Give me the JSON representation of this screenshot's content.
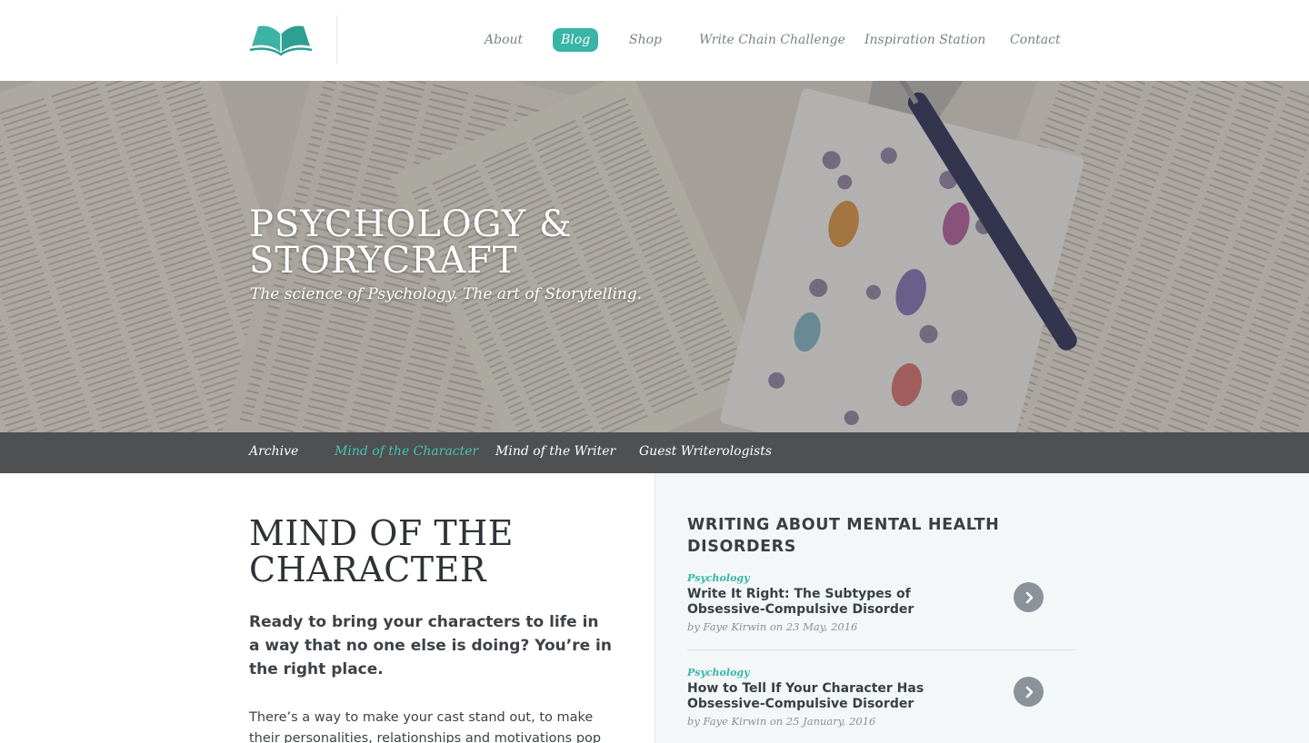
{
  "header": {
    "logo_icon": "open-book-icon",
    "nav": [
      {
        "label": "About",
        "active": false
      },
      {
        "label": "Blog",
        "active": true
      },
      {
        "label": "Shop",
        "active": false
      },
      {
        "label": "Write Chain Challenge",
        "active": false
      },
      {
        "label": "Inspiration Station",
        "active": false
      },
      {
        "label": "Contact",
        "active": false
      }
    ]
  },
  "hero": {
    "title_line1": "PSYCHOLOGY &",
    "title_line2": "STORYCRAFT",
    "subtitle": "The science of Psychology. The art of Storytelling."
  },
  "subnav": {
    "items": [
      {
        "label": "Archive",
        "active": false
      },
      {
        "label": "Mind of the Character",
        "active": true
      },
      {
        "label": "Mind of the Writer",
        "active": false
      },
      {
        "label": "Guest Writerologists",
        "active": false
      }
    ]
  },
  "main": {
    "title_line1": "MIND OF THE",
    "title_line2": "CHARACTER",
    "lead": "Ready to bring your characters to life in a way that no one else is doing? You’re in the right place.",
    "body": "There’s a way to make your cast stand out, to make their personalities, relationships and motivations pop off the"
  },
  "sidebar": {
    "heading": "WRITING ABOUT MENTAL HEALTH DISORDERS",
    "posts": [
      {
        "category": "Psychology",
        "title": "Write It Right: The Subtypes of Obsessive-Compulsive Disorder",
        "meta": "by Faye Kirwin on 23 May, 2016",
        "arrow_icon": "chevron-right-icon"
      },
      {
        "category": "Psychology",
        "title": "How to Tell If Your Character Has Obsessive-Compulsive Disorder",
        "meta": "by Faye Kirwin on 25 January, 2016",
        "arrow_icon": "chevron-right-icon"
      }
    ]
  },
  "colors": {
    "accent": "#39b5a6",
    "subnav_bg": "#4f5052",
    "sidebar_bg": "#f3f7f8"
  }
}
